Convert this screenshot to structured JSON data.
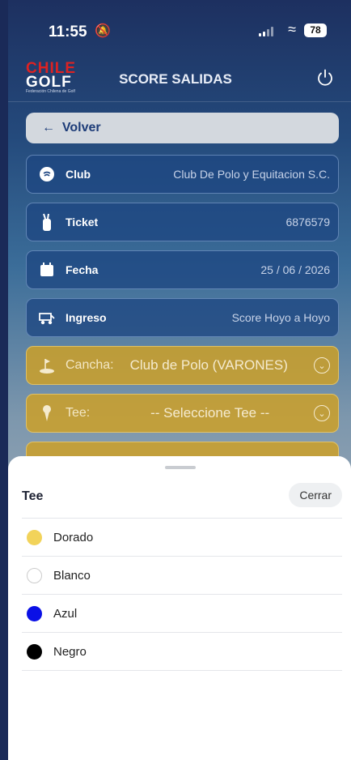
{
  "status_bar": {
    "time": "11:55",
    "battery": "78"
  },
  "header": {
    "logo_line1": "CHILE",
    "logo_line2": "GOLF",
    "logo_line3": "Federación Chilena de Golf",
    "title": "SCORE SALIDAS"
  },
  "back": {
    "label": "Volver"
  },
  "fields": [
    {
      "label": "Club",
      "value": "Club De Polo y Equitacion S.C.",
      "icon": "shield-icon"
    },
    {
      "label": "Ticket",
      "value": "6876579",
      "icon": "golf-bag-icon"
    },
    {
      "label": "Fecha",
      "value": "25 / 06 / 2026",
      "icon": "calendar-icon"
    },
    {
      "label": "Ingreso",
      "value": "Score Hoyo a Hoyo",
      "icon": "golf-cart-icon"
    }
  ],
  "cancha": {
    "label": "Cancha:",
    "value": "Club de Polo (VARONES)"
  },
  "tee_select": {
    "label": "Tee:",
    "value": "-- Seleccione Tee --"
  },
  "sheet": {
    "title": "Tee",
    "close_label": "Cerrar",
    "options": [
      {
        "name": "Dorado",
        "color": "#f2d35a"
      },
      {
        "name": "Blanco",
        "color": "#ffffff"
      },
      {
        "name": "Azul",
        "color": "#0a10e6"
      },
      {
        "name": "Negro",
        "color": "#000000"
      }
    ]
  },
  "colors": {
    "primary": "#1e4682",
    "accent": "#cda028"
  }
}
